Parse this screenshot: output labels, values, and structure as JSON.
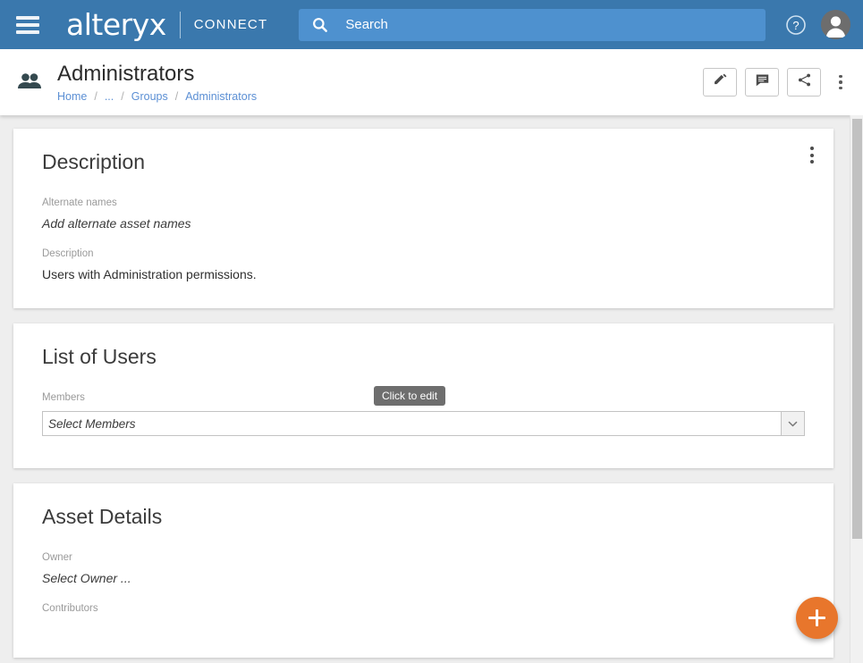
{
  "topnav": {
    "menu_icon": "hamburger-icon",
    "brand": "alteryx",
    "brand_sub": "CONNECT",
    "search": {
      "icon": "search-icon",
      "placeholder": "Search",
      "value": ""
    },
    "help_icon": "help-circle-icon",
    "avatar_icon": "user-avatar-icon"
  },
  "pagehead": {
    "icon": "group-people-icon",
    "title": "Administrators",
    "breadcrumb": [
      {
        "label": "Home"
      },
      {
        "label": "..."
      },
      {
        "label": "Groups"
      },
      {
        "label": "Administrators"
      }
    ],
    "separator": "/",
    "actions": [
      {
        "name": "edit-button",
        "icon": "pencil-icon"
      },
      {
        "name": "comment-button",
        "icon": "comment-icon"
      },
      {
        "name": "share-button",
        "icon": "share-icon"
      }
    ],
    "more_menu": "more-vertical-icon"
  },
  "cards": {
    "description": {
      "title": "Description",
      "menu_icon": "more-vertical-icon",
      "alternate_names_label": "Alternate names",
      "alternate_names_value": "Add alternate asset names",
      "description_label": "Description",
      "description_value": "Users with Administration permissions."
    },
    "list_of_users": {
      "title": "List of Users",
      "members_label": "Members",
      "members_placeholder": "Select Members",
      "tooltip": "Click to edit",
      "dropdown_icon": "chevron-down-icon"
    },
    "asset_details": {
      "title": "Asset Details",
      "owner_label": "Owner",
      "owner_value": "Select Owner ...",
      "contributors_label": "Contributors"
    }
  },
  "fab": {
    "icon": "plus-icon",
    "label": "Add"
  },
  "colors": {
    "header_blue": "#3a78ad",
    "search_blue": "#4e91cf",
    "link_blue": "#5b8fd4",
    "accent_orange": "#e8762c",
    "page_bg": "#eeeeee",
    "tooltip_bg": "#6e6e6e"
  }
}
